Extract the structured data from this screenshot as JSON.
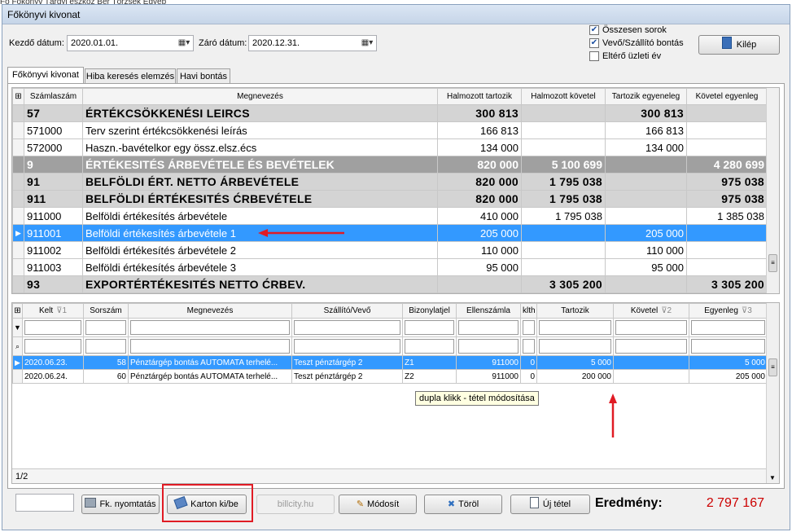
{
  "menu_sliver": "Fő  Főkönyv  Tárgyi eszköz  Bér        Törzsek  Egyéb",
  "window_title": "Főkönyvi kivonat",
  "filters": {
    "start_label": "Kezdő dátum:",
    "start_value": "2020.01.01.",
    "end_label": "Záró dátum:",
    "end_value": "2020.12.31."
  },
  "checkboxes": [
    {
      "label": "Összesen sorok",
      "checked": true
    },
    {
      "label": "Vevő/Szállító bontás",
      "checked": true
    },
    {
      "label": "Eltérő üzleti év",
      "checked": false
    }
  ],
  "exit_label": "Kilép",
  "tabs": [
    "Főkönyvi kivonat",
    "Hiba keresés elemzés",
    "Havi bontás"
  ],
  "accounts_table": {
    "columns": [
      "Számlaszám",
      "Megnevezés",
      "Halmozott tartozik",
      "Halmozott követel",
      "Tartozik egyeneleg",
      "Követel egyenleg"
    ],
    "rows": [
      {
        "code": "57",
        "name": "ÉRTÉKCSÖKKENÉSI LEIRCS",
        "ht": "300 813",
        "hk": "",
        "te": "300 813",
        "ke": "",
        "type": "grp"
      },
      {
        "code": "571000",
        "name": "Terv szerint értékcsökkenési leírás",
        "ht": "166 813",
        "hk": "",
        "te": "166 813",
        "ke": "",
        "type": "row"
      },
      {
        "code": "572000",
        "name": "Haszn.-bavételkor egy össz.elsz.écs",
        "ht": "134 000",
        "hk": "",
        "te": "134 000",
        "ke": "",
        "type": "row"
      },
      {
        "code": "9",
        "name": "ÉRTÉKESITÉS ÁRBEVÉTELE ÉS BEVÉTELEK",
        "ht": "820 000",
        "hk": "5 100 699",
        "te": "",
        "ke": "4 280 699",
        "type": "dark"
      },
      {
        "code": "91",
        "name": "BELFÖLDI ÉRT. NETTO ÁRBEVÉTELE",
        "ht": "820 000",
        "hk": "1 795 038",
        "te": "",
        "ke": "975 038",
        "type": "grp"
      },
      {
        "code": "911",
        "name": "BELFÖLDI ÉRTÉKESITÉS ĆRBEVÉTELE",
        "ht": "820 000",
        "hk": "1 795 038",
        "te": "",
        "ke": "975 038",
        "type": "grp"
      },
      {
        "code": "911000",
        "name": "Belföldi értékesítés árbevétele",
        "ht": "410 000",
        "hk": "1 795 038",
        "te": "",
        "ke": "1 385 038",
        "type": "row"
      },
      {
        "code": "911001",
        "name": "Belföldi értékesítés árbevétele 1",
        "ht": "205 000",
        "hk": "",
        "te": "205 000",
        "ke": "",
        "type": "sel"
      },
      {
        "code": "911002",
        "name": "Belföldi értékesítés árbevétele 2",
        "ht": "110 000",
        "hk": "",
        "te": "110 000",
        "ke": "",
        "type": "row"
      },
      {
        "code": "911003",
        "name": "Belföldi értékesítés árbevétele 3",
        "ht": "95 000",
        "hk": "",
        "te": "95 000",
        "ke": "",
        "type": "row"
      },
      {
        "code": "93",
        "name": "EXPORTÉRTÉKESITÉS NETTO ĆRBEV.",
        "ht": "",
        "hk": "3 305 200",
        "te": "",
        "ke": "3 305 200",
        "type": "grp"
      }
    ]
  },
  "detail_table": {
    "columns": [
      "Kelt",
      "Sorszám",
      "Megnevezés",
      "Szállító/Vevő",
      "Bizonylatjel",
      "Ellenszámla",
      "klth",
      "Tartozik",
      "Követel",
      "Egyenleg"
    ],
    "sort_marks": {
      "Kelt": "1",
      "Követel": "2",
      "Egyenleg": "3"
    },
    "rows": [
      {
        "kelt": "2020.06.23.",
        "sorszam": "58",
        "megnevezes": "Pénztárgép bontás AUTOMATA terhelé...",
        "partner": "Teszt pénztárgép 2",
        "biz": "Z1",
        "ellen": "911000",
        "klth": "0",
        "tartozik": "5 000",
        "kovetel": "",
        "egyenleg": "5 000",
        "selected": true
      },
      {
        "kelt": "2020.06.24.",
        "sorszam": "60",
        "megnevezes": "Pénztárgép bontás AUTOMATA terhelé...",
        "partner": "Teszt pénztárgép 2",
        "biz": "Z2",
        "ellen": "911000",
        "klth": "0",
        "tartozik": "200 000",
        "kovetel": "",
        "egyenleg": "205 000",
        "selected": false
      }
    ],
    "record_counter": "1/2"
  },
  "tooltip": "dupla klikk - tétel módosítása",
  "bottom": {
    "print_label": "Fk. nyomtatás",
    "karton_label": "Karton ki/be",
    "billcity": "billcity.hu",
    "modify_label": "Módosít",
    "delete_label": "Töröl",
    "new_label": "Új tétel",
    "result_label": "Eredmény:",
    "result_value": "2 797 167"
  },
  "colors": {
    "selection": "#3399ff",
    "annotation": "#e01b24",
    "result": "#cc0000"
  }
}
